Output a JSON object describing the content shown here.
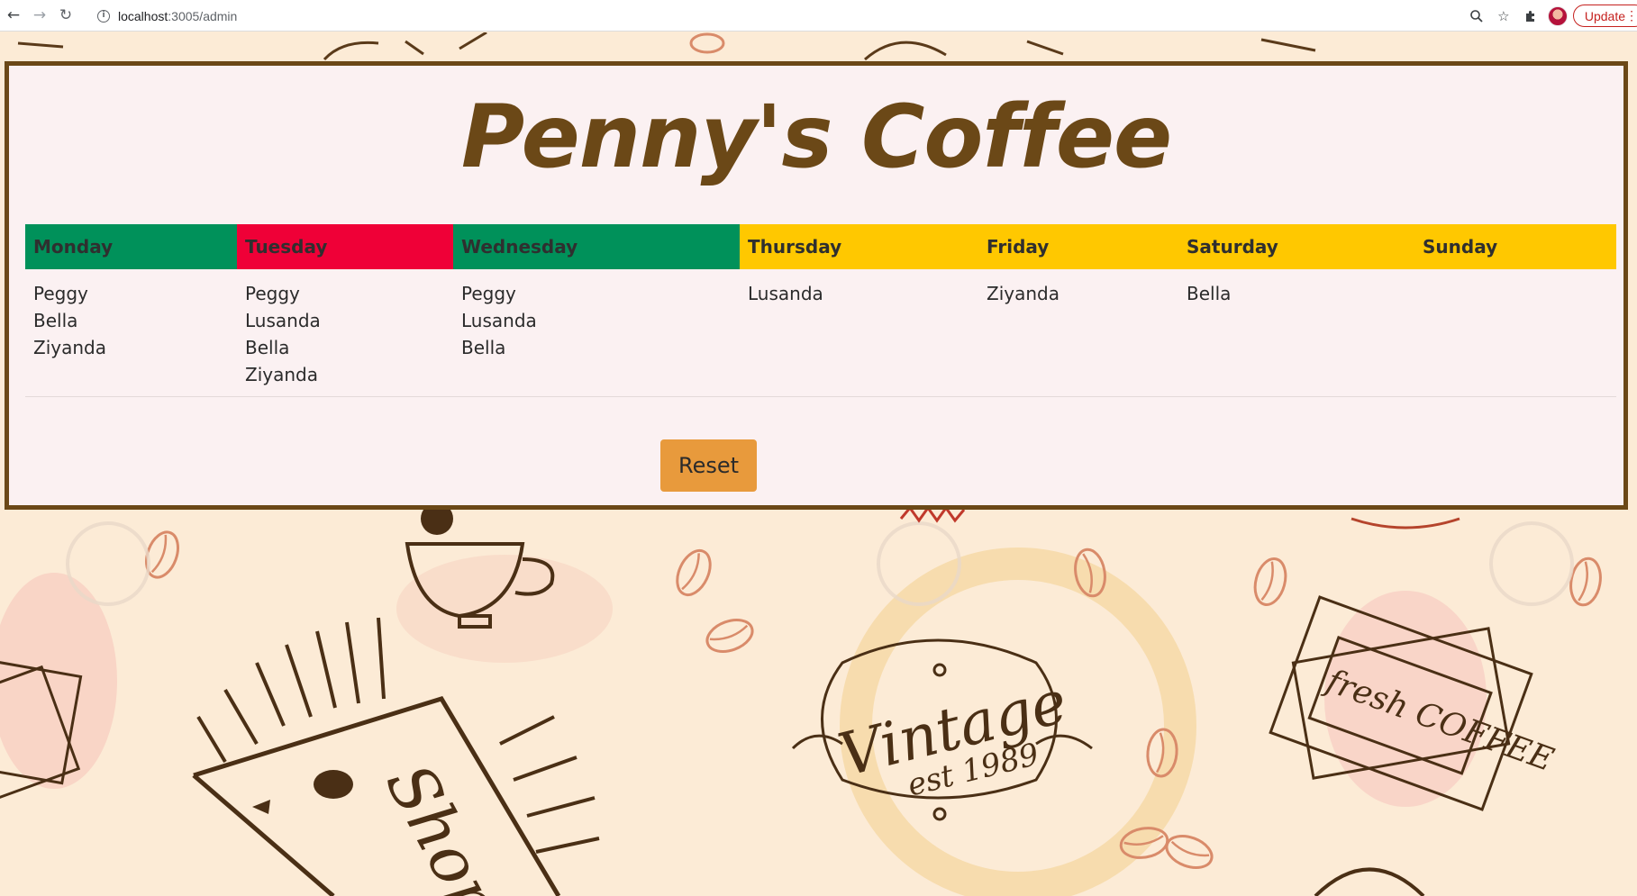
{
  "browser": {
    "url_host": "localhost",
    "url_path": ":3005/admin",
    "update_label": "Update"
  },
  "page": {
    "title": "Penny's Coffee",
    "reset_label": "Reset"
  },
  "schedule": {
    "days": [
      {
        "name": "Monday",
        "color": "#00915a",
        "workers": [
          "Peggy",
          "Bella",
          "Ziyanda"
        ]
      },
      {
        "name": "Tuesday",
        "color": "#ef0037",
        "workers": [
          "Peggy",
          "Lusanda",
          "Bella",
          "Ziyanda"
        ]
      },
      {
        "name": "Wednesday",
        "color": "#00915a",
        "workers": [
          "Peggy",
          "Lusanda",
          "Bella"
        ]
      },
      {
        "name": "Thursday",
        "color": "#ffc800",
        "workers": [
          "Lusanda"
        ]
      },
      {
        "name": "Friday",
        "color": "#ffc800",
        "workers": [
          "Ziyanda"
        ]
      },
      {
        "name": "Saturday",
        "color": "#ffc800",
        "workers": [
          "Bella"
        ]
      },
      {
        "name": "Sunday",
        "color": "#ffc800",
        "workers": []
      }
    ]
  },
  "background": {
    "badge_vintage_top": "Vintage",
    "badge_vintage_bottom": "est 1989",
    "badge_fresh": "fresh COFFEE",
    "badge_shop": "Shop"
  }
}
